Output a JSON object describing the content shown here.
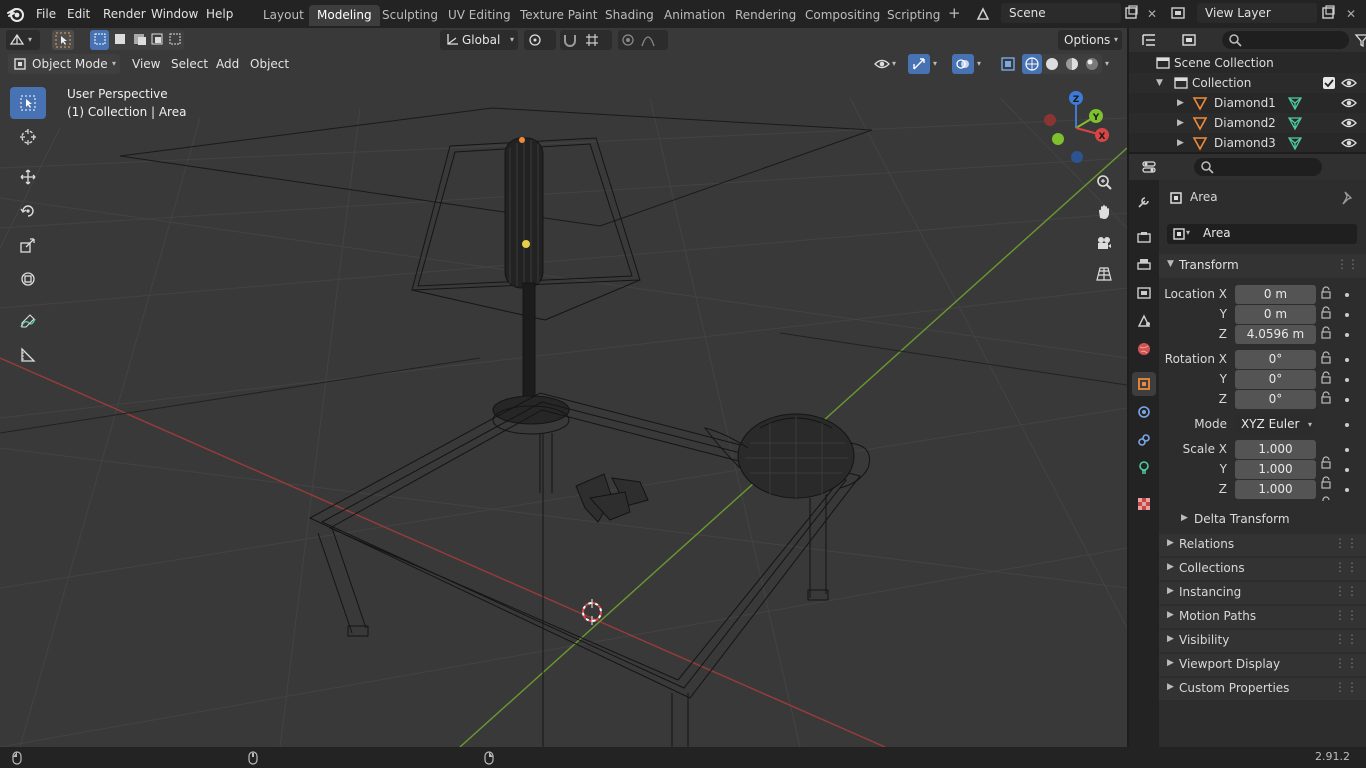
{
  "topbar": {
    "menus": [
      "File",
      "Edit",
      "Render",
      "Window",
      "Help"
    ],
    "workspaces": [
      "Layout",
      "Modeling",
      "Sculpting",
      "UV Editing",
      "Texture Paint",
      "Shading",
      "Animation",
      "Rendering",
      "Compositing",
      "Scripting"
    ],
    "active_workspace": "Modeling",
    "scene_name": "Scene",
    "view_layer_name": "View Layer"
  },
  "viewport": {
    "transform_orientation": "Global",
    "options_label": "Options",
    "mode": "Object Mode",
    "menus": [
      "View",
      "Select",
      "Add",
      "Object"
    ],
    "overlay_line1": "User Perspective",
    "overlay_line2": "(1) Collection | Area",
    "gizmo_axes": {
      "x": "X",
      "y": "Y",
      "z": "Z"
    }
  },
  "outliner": {
    "rows": [
      {
        "label": "Scene Collection",
        "icon": "scene-collection-icon"
      },
      {
        "label": "Collection",
        "icon": "collection-icon"
      },
      {
        "label": "Diamond1",
        "icon": "mesh-object-icon"
      },
      {
        "label": "Diamond2",
        "icon": "mesh-object-icon"
      },
      {
        "label": "Diamond3",
        "icon": "mesh-object-icon"
      }
    ]
  },
  "properties": {
    "object_title": "Area",
    "object_name": "Area",
    "transform_label": "Transform",
    "location": {
      "label": "Location X",
      "x": "0 m",
      "y": "0 m",
      "z": "4.0596 m"
    },
    "rotation": {
      "label": "Rotation X",
      "x": "0°",
      "y": "0°",
      "z": "0°"
    },
    "mode_label": "Mode",
    "mode_value": "XYZ Euler",
    "scale": {
      "label": "Scale X",
      "x": "1.000",
      "y": "1.000",
      "z": "1.000"
    },
    "axis_labels": {
      "y": "Y",
      "z": "Z"
    },
    "delta_transform": "Delta Transform",
    "sections": [
      "Relations",
      "Collections",
      "Instancing",
      "Motion Paths",
      "Visibility",
      "Viewport Display",
      "Custom Properties"
    ]
  },
  "statusbar": {
    "version": "2.91.2"
  },
  "colors": {
    "accent": "#4772b3",
    "x_axis": "#d84545",
    "y_axis": "#7fc02f",
    "z_axis": "#3d7bd8",
    "object_orange": "#f08a38"
  }
}
